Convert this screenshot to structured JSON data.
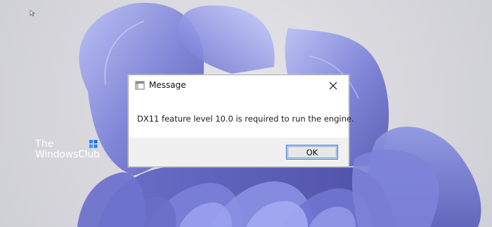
{
  "dialog": {
    "title": "Message",
    "message": "DX11 feature level 10.0 is required to run the engine.",
    "ok_label": "OK"
  },
  "watermark": {
    "line1": "The",
    "line2": "WindowsClub"
  },
  "icons": {
    "title_icon": "window-app-icon",
    "close": "close-icon",
    "cursor": "mouse-cursor-icon",
    "logo": "windows-logo-icon"
  },
  "colors": {
    "accent_focus": "#2f6fdb",
    "wallpaper_primary": "#6f76c8",
    "wallpaper_light": "#a9b2f2"
  }
}
